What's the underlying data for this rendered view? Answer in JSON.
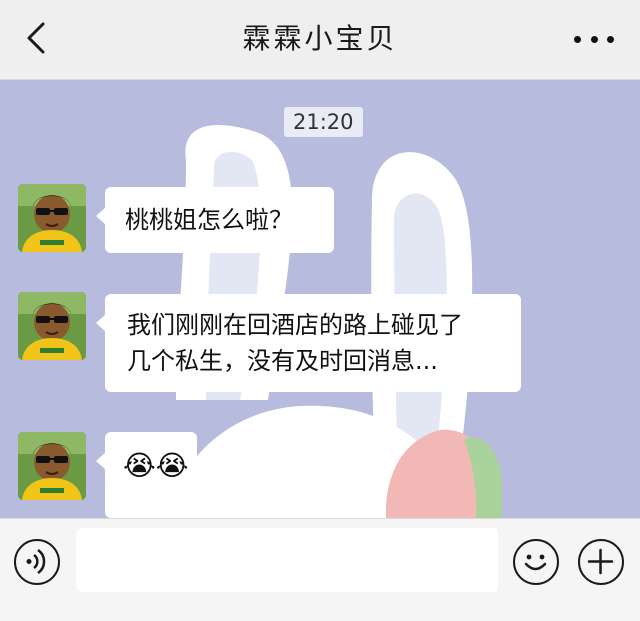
{
  "header": {
    "title": "霖霖小宝贝",
    "back_icon": "chevron-left-icon",
    "more_icon": "more-dots-icon"
  },
  "chat": {
    "timestamp": "21:20",
    "messages": [
      {
        "sender": "contact",
        "lines": [
          "桃桃姐怎么啦？"
        ]
      },
      {
        "sender": "contact",
        "lines": [
          "我们刚刚在回酒店的路上碰见了",
          "几个私生，没有及时回消息..."
        ]
      },
      {
        "sender": "contact",
        "lines": [
          "😭😭"
        ]
      }
    ]
  },
  "input_bar": {
    "voice_icon": "voice-icon",
    "input_value": "",
    "emoji_icon": "emoji-icon",
    "plus_icon": "plus-icon"
  },
  "colors": {
    "chat_background": "#b7bcdf",
    "header_background": "#efefef",
    "bubble": "#ffffff"
  }
}
